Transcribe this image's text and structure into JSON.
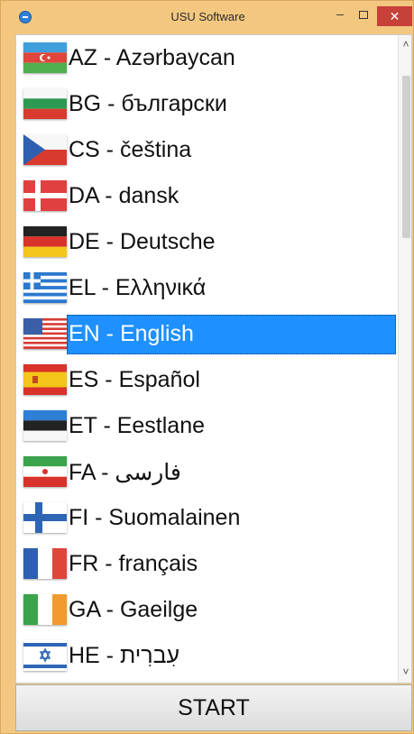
{
  "window": {
    "title": "USU Software",
    "controls": {
      "minimize": "–",
      "close": "✕"
    }
  },
  "languages": {
    "items": [
      {
        "label": "AZ - Azərbaycan",
        "flag": "azerbaijan-flag-icon"
      },
      {
        "label": "BG - български",
        "flag": "bulgaria-flag-icon"
      },
      {
        "label": "CS - čeština",
        "flag": "czech-flag-icon"
      },
      {
        "label": "DA - dansk",
        "flag": "denmark-flag-icon"
      },
      {
        "label": "DE - Deutsche",
        "flag": "germany-flag-icon"
      },
      {
        "label": "EL - Ελληνικά",
        "flag": "greece-flag-icon"
      },
      {
        "label": "EN - English",
        "flag": "usa-flag-icon",
        "selected": true
      },
      {
        "label": "ES - Español",
        "flag": "spain-flag-icon"
      },
      {
        "label": "ET - Eestlane",
        "flag": "estonia-flag-icon"
      },
      {
        "label": "FA - فارسی",
        "flag": "iran-flag-icon"
      },
      {
        "label": "FI - Suomalainen",
        "flag": "finland-flag-icon"
      },
      {
        "label": "FR - français",
        "flag": "france-flag-icon"
      },
      {
        "label": "GA - Gaeilge",
        "flag": "ireland-flag-icon"
      },
      {
        "label": "HE - עִברִית",
        "flag": "israel-flag-icon"
      }
    ]
  },
  "scrollbar": {
    "up": "˄",
    "down": "˅"
  },
  "footer": {
    "start_label": "START"
  }
}
